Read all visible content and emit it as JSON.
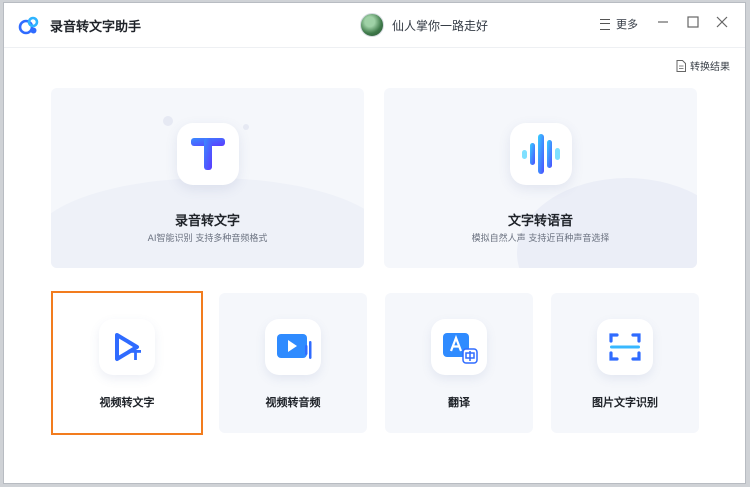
{
  "app": {
    "title": "录音转文字助手",
    "accent": "#2f6bff"
  },
  "user": {
    "name": "仙人掌你一路走好"
  },
  "header": {
    "more_label": "更多",
    "results_label": "转换结果"
  },
  "features_large": [
    {
      "title": "录音转文字",
      "subtitle": "AI智能识别 支持多种音频格式",
      "icon": "text-t-icon"
    },
    {
      "title": "文字转语音",
      "subtitle": "模拟自然人声 支持近百种声音选择",
      "icon": "voice-wave-icon"
    }
  ],
  "features_small": [
    {
      "title": "视频转文字",
      "icon": "video-to-text-icon",
      "selected": true
    },
    {
      "title": "视频转音频",
      "icon": "video-to-audio-icon",
      "selected": false
    },
    {
      "title": "翻译",
      "icon": "translate-icon",
      "selected": false
    },
    {
      "title": "图片文字识别",
      "icon": "scan-ocr-icon",
      "selected": false
    }
  ],
  "colors": {
    "selected_border": "#f27c1e",
    "card_bg": "#f5f7fb",
    "icon_blue": "#2f6bff"
  }
}
